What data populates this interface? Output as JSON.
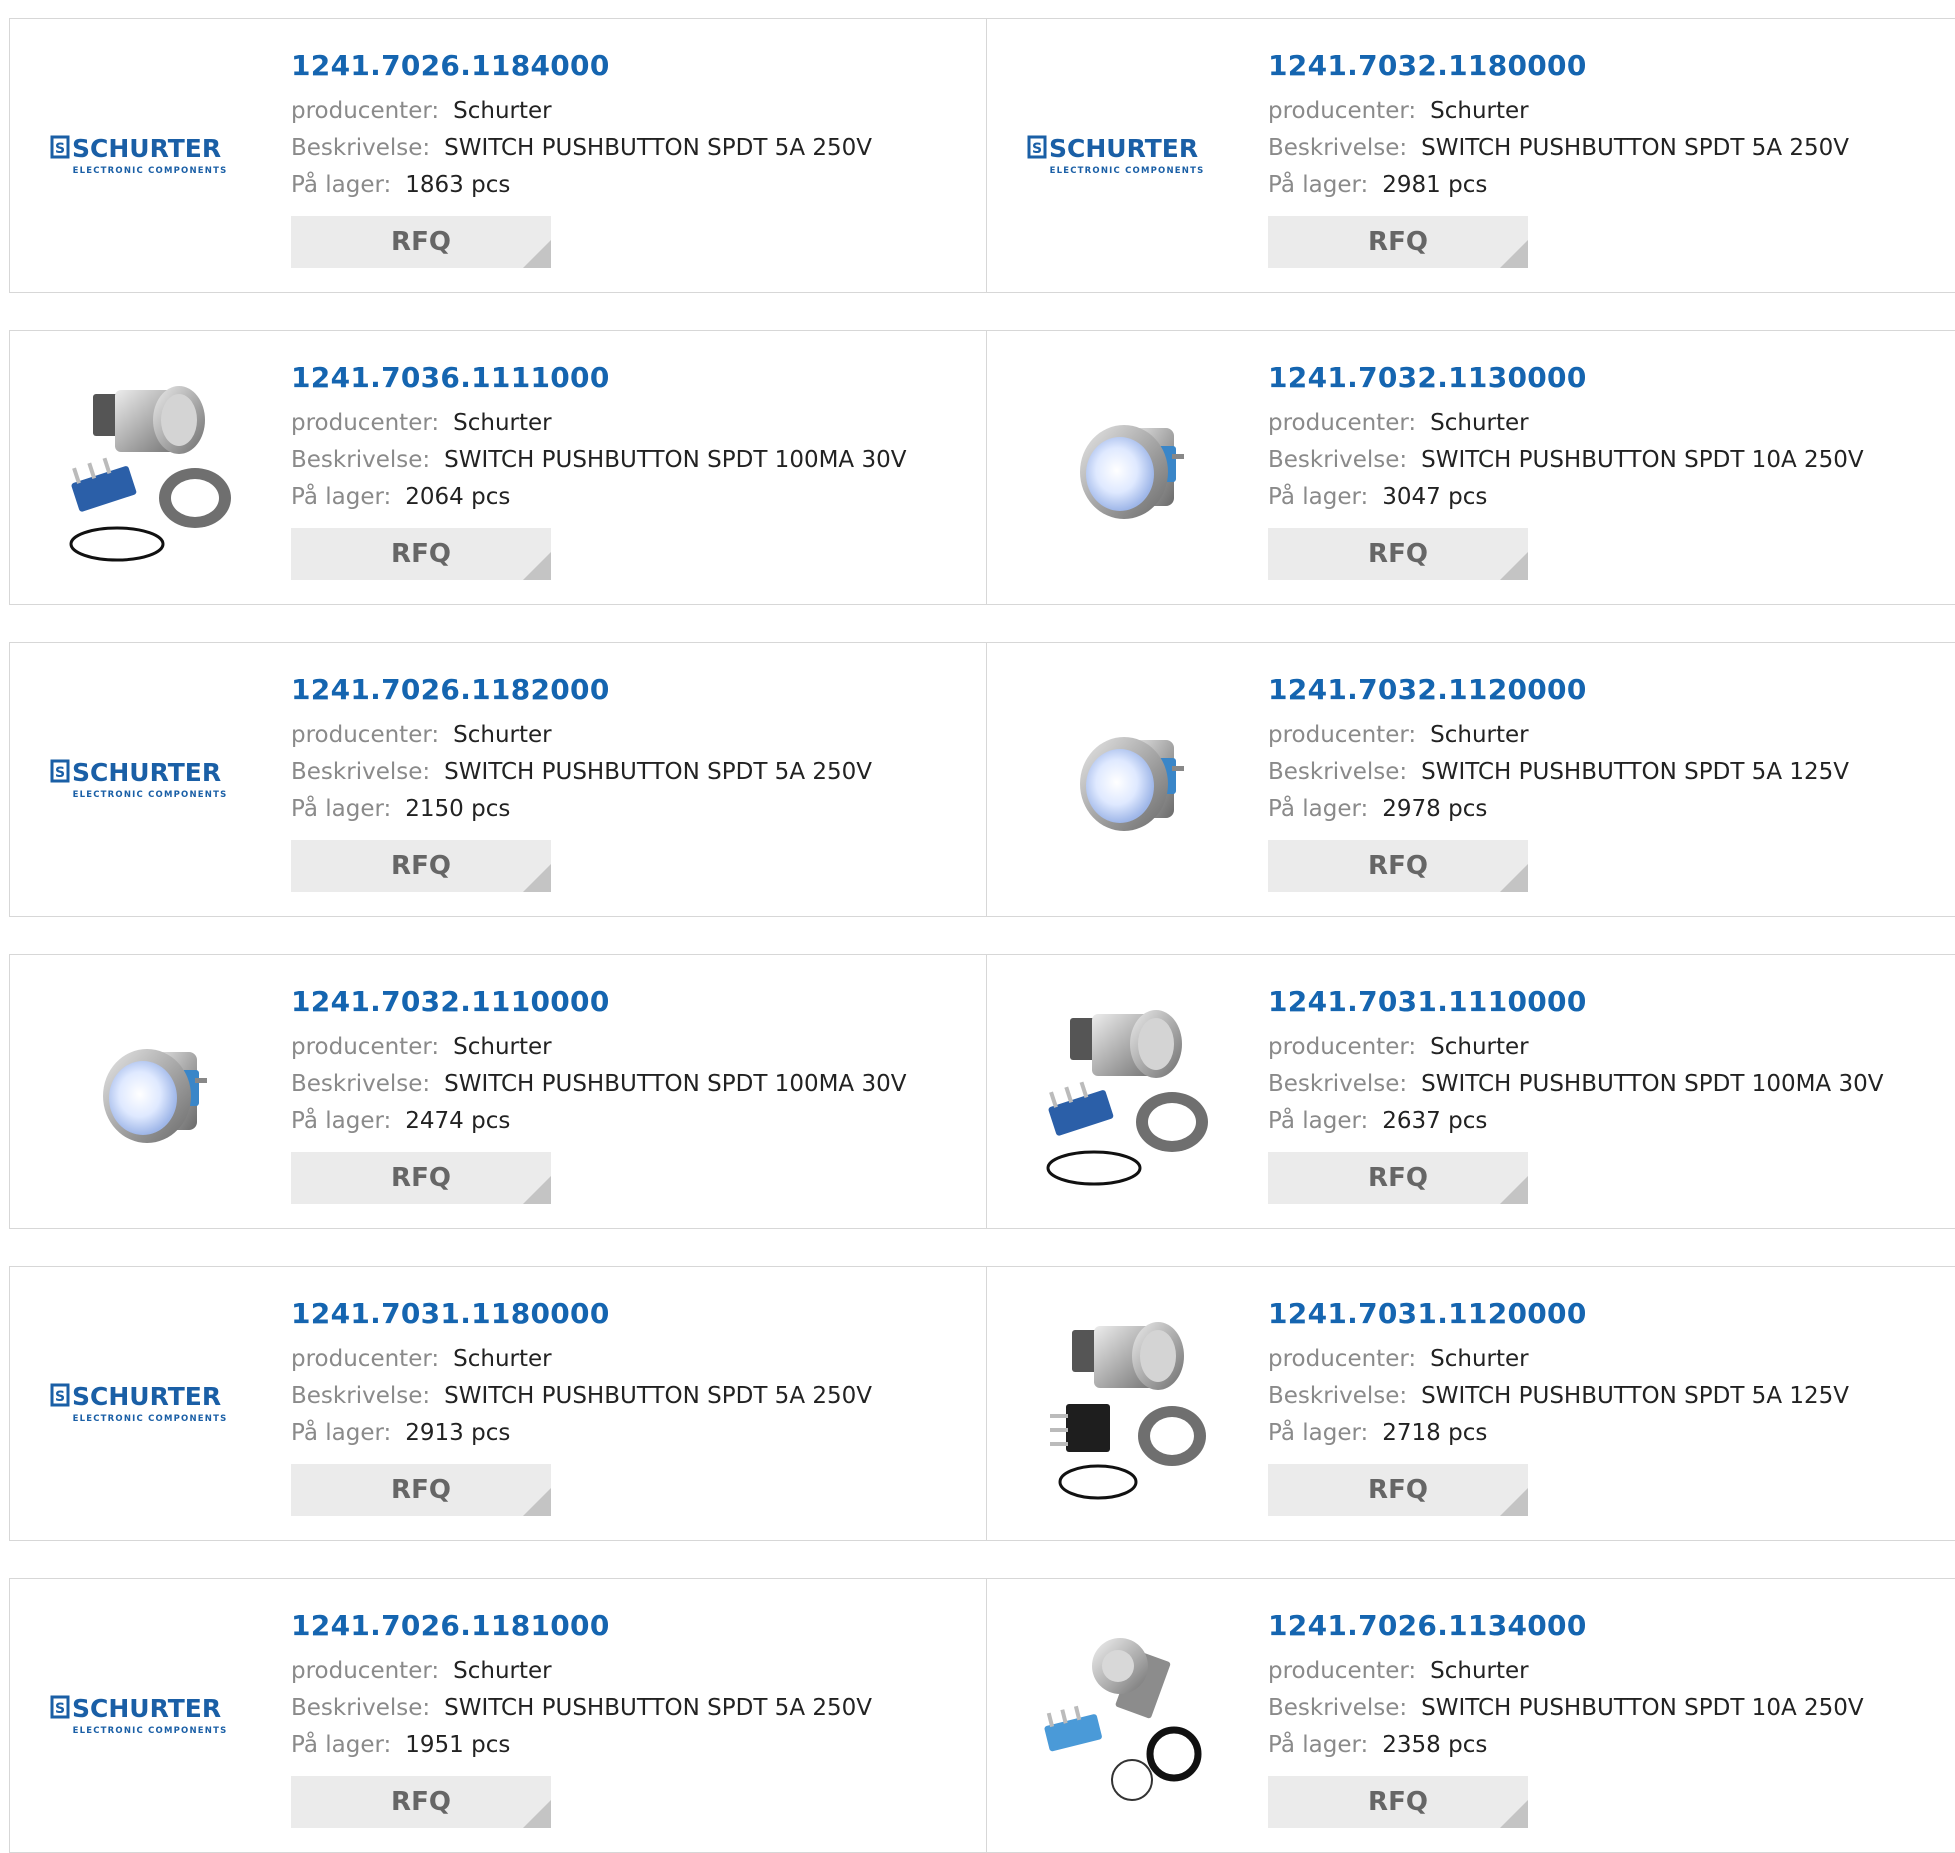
{
  "labels": {
    "manufacturer": "producenter:",
    "description": "Beskrivelse:",
    "stock": "På lager:",
    "rfq": "RFQ"
  },
  "brand": {
    "logo_text": "SCHURTER",
    "logo_subtext": "ELECTRONIC COMPONENTS",
    "logo_color": "#1a5fa6"
  },
  "colors": {
    "part_link": "#1565b0",
    "label_grey": "#8a8a8a",
    "rfq_bg": "#ebebeb"
  },
  "products": [
    {
      "part": "1241.7026.1184000",
      "manufacturer": "Schurter",
      "description": "SWITCH PUSHBUTTON SPDT 5A 250V",
      "stock": "1863 pcs",
      "image": "schurter-logo"
    },
    {
      "part": "1241.7032.1180000",
      "manufacturer": "Schurter",
      "description": "SWITCH PUSHBUTTON SPDT 5A 250V",
      "stock": "2981 pcs",
      "image": "schurter-logo"
    },
    {
      "part": "1241.7036.1111000",
      "manufacturer": "Schurter",
      "description": "SWITCH PUSHBUTTON SPDT 100MA 30V",
      "stock": "2064 pcs",
      "image": "pushbutton-kit-photo"
    },
    {
      "part": "1241.7032.1130000",
      "manufacturer": "Schurter",
      "description": "SWITCH PUSHBUTTON SPDT 10A 250V",
      "stock": "3047 pcs",
      "image": "illuminated-pushbutton-photo"
    },
    {
      "part": "1241.7026.1182000",
      "manufacturer": "Schurter",
      "description": "SWITCH PUSHBUTTON SPDT 5A 250V",
      "stock": "2150 pcs",
      "image": "schurter-logo"
    },
    {
      "part": "1241.7032.1120000",
      "manufacturer": "Schurter",
      "description": "SWITCH PUSHBUTTON SPDT 5A 125V",
      "stock": "2978 pcs",
      "image": "illuminated-pushbutton-photo"
    },
    {
      "part": "1241.7032.1110000",
      "manufacturer": "Schurter",
      "description": "SWITCH PUSHBUTTON SPDT 100MA 30V",
      "stock": "2474 pcs",
      "image": "illuminated-pushbutton-photo"
    },
    {
      "part": "1241.7031.1110000",
      "manufacturer": "Schurter",
      "description": "SWITCH PUSHBUTTON SPDT 100MA 30V",
      "stock": "2637 pcs",
      "image": "pushbutton-kit-photo"
    },
    {
      "part": "1241.7031.1180000",
      "manufacturer": "Schurter",
      "description": "SWITCH PUSHBUTTON SPDT 5A 250V",
      "stock": "2913 pcs",
      "image": "schurter-logo"
    },
    {
      "part": "1241.7031.1120000",
      "manufacturer": "Schurter",
      "description": "SWITCH PUSHBUTTON SPDT 5A 125V",
      "stock": "2718 pcs",
      "image": "pushbutton-kit-black-switch-photo"
    },
    {
      "part": "1241.7026.1181000",
      "manufacturer": "Schurter",
      "description": "SWITCH PUSHBUTTON SPDT 5A 250V",
      "stock": "1951 pcs",
      "image": "schurter-logo"
    },
    {
      "part": "1241.7026.1134000",
      "manufacturer": "Schurter",
      "description": "SWITCH PUSHBUTTON SPDT 10A 250V",
      "stock": "2358 pcs",
      "image": "pushbutton-kit-small-photo"
    }
  ]
}
